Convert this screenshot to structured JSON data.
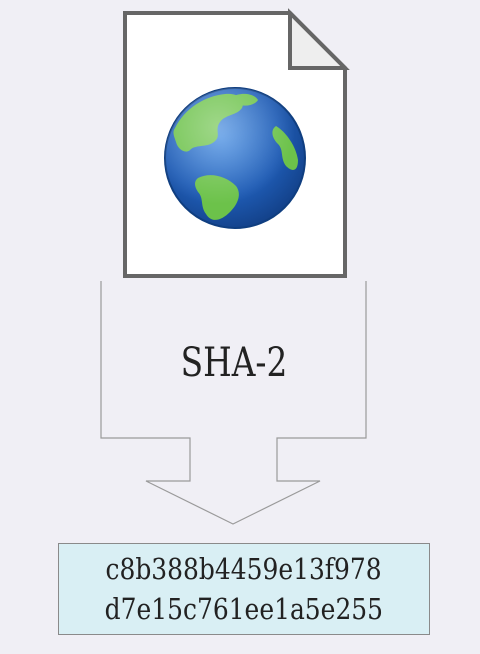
{
  "algorithm_label": "SHA-2",
  "hash": {
    "line1": "c8b388b4459e13f978",
    "line2": "d7e15c761ee1a5e255"
  },
  "colors": {
    "background": "#f0eff5",
    "document_border": "#666666",
    "globe_ocean": "#1f5cb5",
    "globe_land": "#6cc24a",
    "hash_box_fill": "#d9eff4"
  },
  "icons": {
    "document": "web-document-icon",
    "globe": "globe-icon",
    "arrow": "down-arrow"
  }
}
